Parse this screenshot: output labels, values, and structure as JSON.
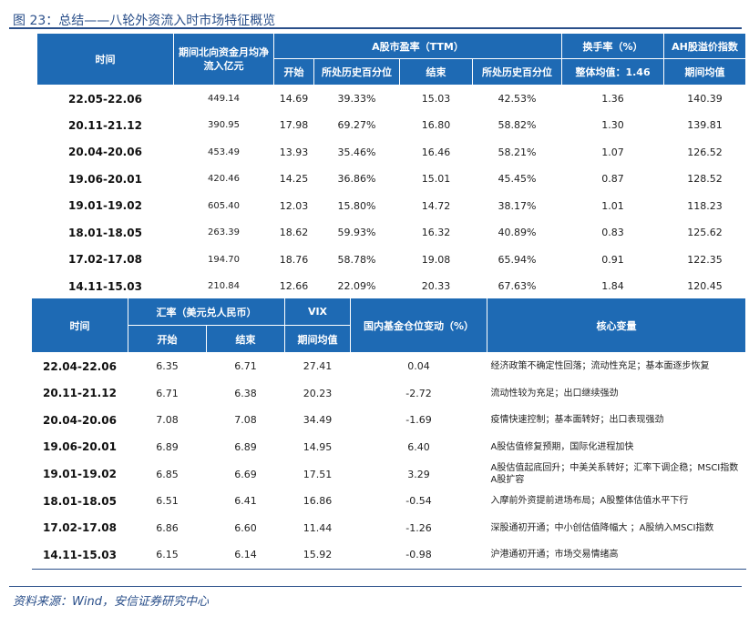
{
  "figure": {
    "title": "图 23：总结——八轮外资流入时市场特征概览",
    "source": "资料来源：Wind，安信证券研究中心"
  },
  "table1": {
    "headers": {
      "time": "时间",
      "flow": "期间北向资金月均净流入亿元",
      "pe_group": "A股市盈率（TTM）",
      "pe_start": "开始",
      "pe_start_pct": "所处历史百分位",
      "pe_end": "结束",
      "pe_end_pct": "所处历史百分位",
      "turnover_group": "换手率（%）",
      "turnover_avg": "整体均值：1.46",
      "ah_group": "AH股溢价指数",
      "ah_avg": "期间均值"
    },
    "rows": [
      {
        "period": "22.05-22.06",
        "flow": "449.14",
        "pe_start": "14.69",
        "pe_start_pct": "39.33%",
        "pe_end": "15.03",
        "pe_end_pct": "42.53%",
        "turnover": "1.36",
        "ah": "140.39"
      },
      {
        "period": "20.11-21.12",
        "flow": "390.95",
        "pe_start": "17.98",
        "pe_start_pct": "69.27%",
        "pe_end": "16.80",
        "pe_end_pct": "58.82%",
        "turnover": "1.30",
        "ah": "139.81"
      },
      {
        "period": "20.04-20.06",
        "flow": "453.49",
        "pe_start": "13.93",
        "pe_start_pct": "35.46%",
        "pe_end": "16.46",
        "pe_end_pct": "58.21%",
        "turnover": "1.07",
        "ah": "126.52"
      },
      {
        "period": "19.06-20.01",
        "flow": "420.46",
        "pe_start": "14.25",
        "pe_start_pct": "36.86%",
        "pe_end": "15.01",
        "pe_end_pct": "45.45%",
        "turnover": "0.87",
        "ah": "128.52"
      },
      {
        "period": "19.01-19.02",
        "flow": "605.40",
        "pe_start": "12.03",
        "pe_start_pct": "15.80%",
        "pe_end": "14.72",
        "pe_end_pct": "38.17%",
        "turnover": "1.01",
        "ah": "118.23"
      },
      {
        "period": "18.01-18.05",
        "flow": "263.39",
        "pe_start": "18.62",
        "pe_start_pct": "59.93%",
        "pe_end": "16.32",
        "pe_end_pct": "40.89%",
        "turnover": "0.83",
        "ah": "125.62"
      },
      {
        "period": "17.02-17.08",
        "flow": "194.70",
        "pe_start": "18.76",
        "pe_start_pct": "58.78%",
        "pe_end": "19.08",
        "pe_end_pct": "65.94%",
        "turnover": "0.91",
        "ah": "122.35"
      },
      {
        "period": "14.11-15.03",
        "flow": "210.84",
        "pe_start": "12.66",
        "pe_start_pct": "22.09%",
        "pe_end": "20.33",
        "pe_end_pct": "67.63%",
        "turnover": "1.84",
        "ah": "120.45"
      }
    ]
  },
  "table2": {
    "headers": {
      "time": "时间",
      "fx_group": "汇率（美元兑人民币）",
      "fx_start": "开始",
      "fx_end": "结束",
      "vix_group": "VIX",
      "vix_avg": "期间均值",
      "fund_change": "国内基金仓位变动（%）",
      "core": "核心变量"
    },
    "rows": [
      {
        "period": "22.04-22.06",
        "fx_start": "6.35",
        "fx_end": "6.71",
        "vix": "27.41",
        "fund": "0.04",
        "core": "经济政策不确定性回落；流动性充足；基本面逐步恢复"
      },
      {
        "period": "20.11-21.12",
        "fx_start": "6.71",
        "fx_end": "6.38",
        "vix": "20.23",
        "fund": "-2.72",
        "core": "流动性较为充足；出口继续强劲"
      },
      {
        "period": "20.04-20.06",
        "fx_start": "7.08",
        "fx_end": "7.08",
        "vix": "34.49",
        "fund": "-1.69",
        "core": "疫情快速控制；基本面转好；出口表现强劲"
      },
      {
        "period": "19.06-20.01",
        "fx_start": "6.89",
        "fx_end": "6.89",
        "vix": "14.95",
        "fund": "6.40",
        "core": "A股估值修复预期，国际化进程加快"
      },
      {
        "period": "19.01-19.02",
        "fx_start": "6.85",
        "fx_end": "6.69",
        "vix": "17.51",
        "fund": "3.29",
        "core": "A股估值起底回升；中美关系转好；汇率下调企稳；MSCI指数A股扩容"
      },
      {
        "period": "18.01-18.05",
        "fx_start": "6.51",
        "fx_end": "6.41",
        "vix": "16.86",
        "fund": "-0.54",
        "core": "入摩前外资提前进场布局；A股整体估值水平下行"
      },
      {
        "period": "17.02-17.08",
        "fx_start": "6.86",
        "fx_end": "6.60",
        "vix": "11.44",
        "fund": "-1.26",
        "core": "深股通初开通；中小创估值降幅大 ；A股纳入MSCI指数"
      },
      {
        "period": "14.11-15.03",
        "fx_start": "6.15",
        "fx_end": "6.14",
        "vix": "15.92",
        "fund": "-0.98",
        "core": "沪港通初开通；市场交易情绪高"
      }
    ]
  }
}
